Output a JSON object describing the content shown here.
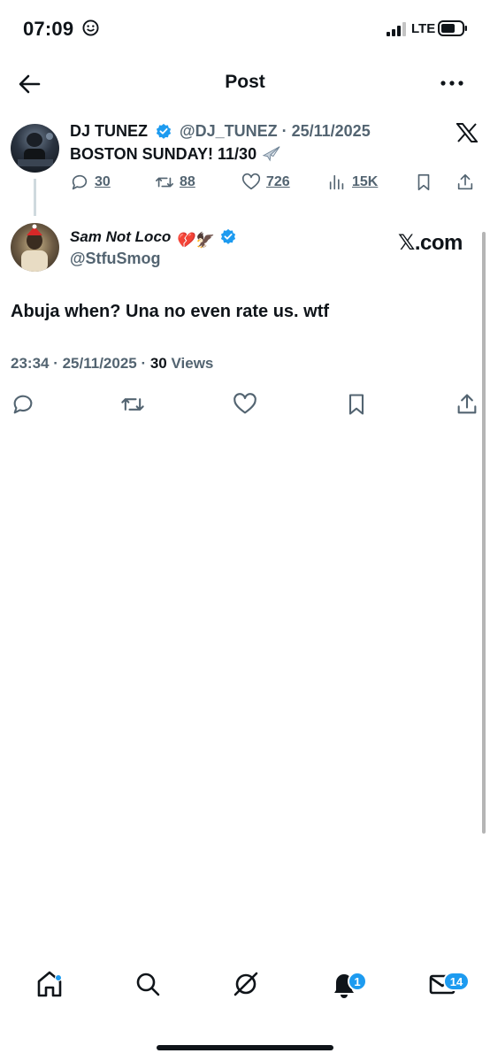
{
  "status_bar": {
    "time": "07:09",
    "network": "LTE"
  },
  "header": {
    "title": "Post",
    "back_icon": "arrow-left-icon",
    "more_icon": "more-horizontal-icon"
  },
  "parent_tweet": {
    "name": "DJ TUNEZ",
    "handle_date": "@DJ_TUNEZ · 25/11/2025",
    "text": "BOSTON SUNDAY! 11/30",
    "metrics": {
      "replies": "30",
      "reposts": "88",
      "likes": "726",
      "views": "15K"
    }
  },
  "reply_tweet": {
    "name": "Sam Not Loco",
    "name_emoji": "💔🦅",
    "handle": "@StfuSmog",
    "watermark": "𝕏.com",
    "text": "Abuja when? Una no even rate us. wtf",
    "time_date": "23:34 · 25/11/2025 · ",
    "views_count": "30",
    "views_label": " Views"
  },
  "bottom_nav": {
    "notifications_badge": "1",
    "messages_badge": "14"
  },
  "colors": {
    "accent": "#1d9bf0",
    "text": "#0f1419",
    "secondary": "#536471"
  }
}
